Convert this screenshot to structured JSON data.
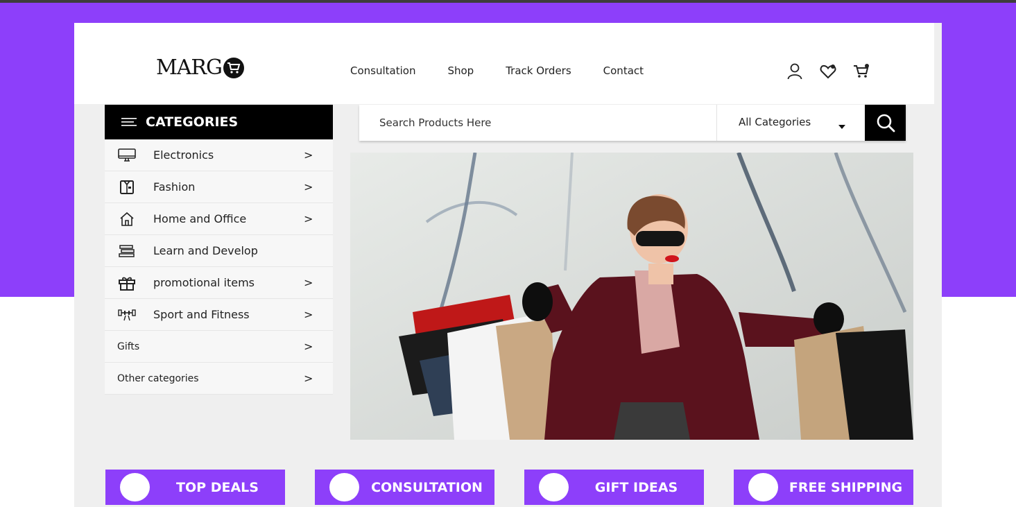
{
  "brand": {
    "logo_text": "MARG",
    "logo_accent": "#8d3ffa"
  },
  "nav": {
    "items": [
      "Consultation",
      "Shop",
      "Track Orders",
      "Contact"
    ]
  },
  "header_icons": [
    "user-icon",
    "heart-icon",
    "cart-icon"
  ],
  "categories": {
    "title": "CATEGORIES",
    "items": [
      {
        "label": "Electronics",
        "icon": "monitor-icon",
        "arrow": ">"
      },
      {
        "label": "Fashion",
        "icon": "shirt-icon",
        "arrow": ">"
      },
      {
        "label": "Home and Office",
        "icon": "home-icon",
        "arrow": ">"
      },
      {
        "label": "Learn and Develop",
        "icon": "books-icon",
        "arrow": ""
      },
      {
        "label": "promotional items",
        "icon": "gift-icon",
        "arrow": ">"
      },
      {
        "label": "Sport and Fitness",
        "icon": "dumbbell-icon",
        "arrow": ">"
      },
      {
        "label": "Gifts",
        "icon": "",
        "arrow": ">"
      },
      {
        "label": "Other categories",
        "icon": "",
        "arrow": ">"
      }
    ]
  },
  "search": {
    "placeholder": "Search Products Here",
    "category": "All Categories"
  },
  "promos": [
    {
      "label": "TOP DEALS"
    },
    {
      "label": "CONSULTATION"
    },
    {
      "label": "GIFT IDEAS"
    },
    {
      "label": "FREE SHIPPING"
    }
  ],
  "colors": {
    "accent": "#8d3ffa",
    "dark": "#000000",
    "panel": "#efefef"
  }
}
